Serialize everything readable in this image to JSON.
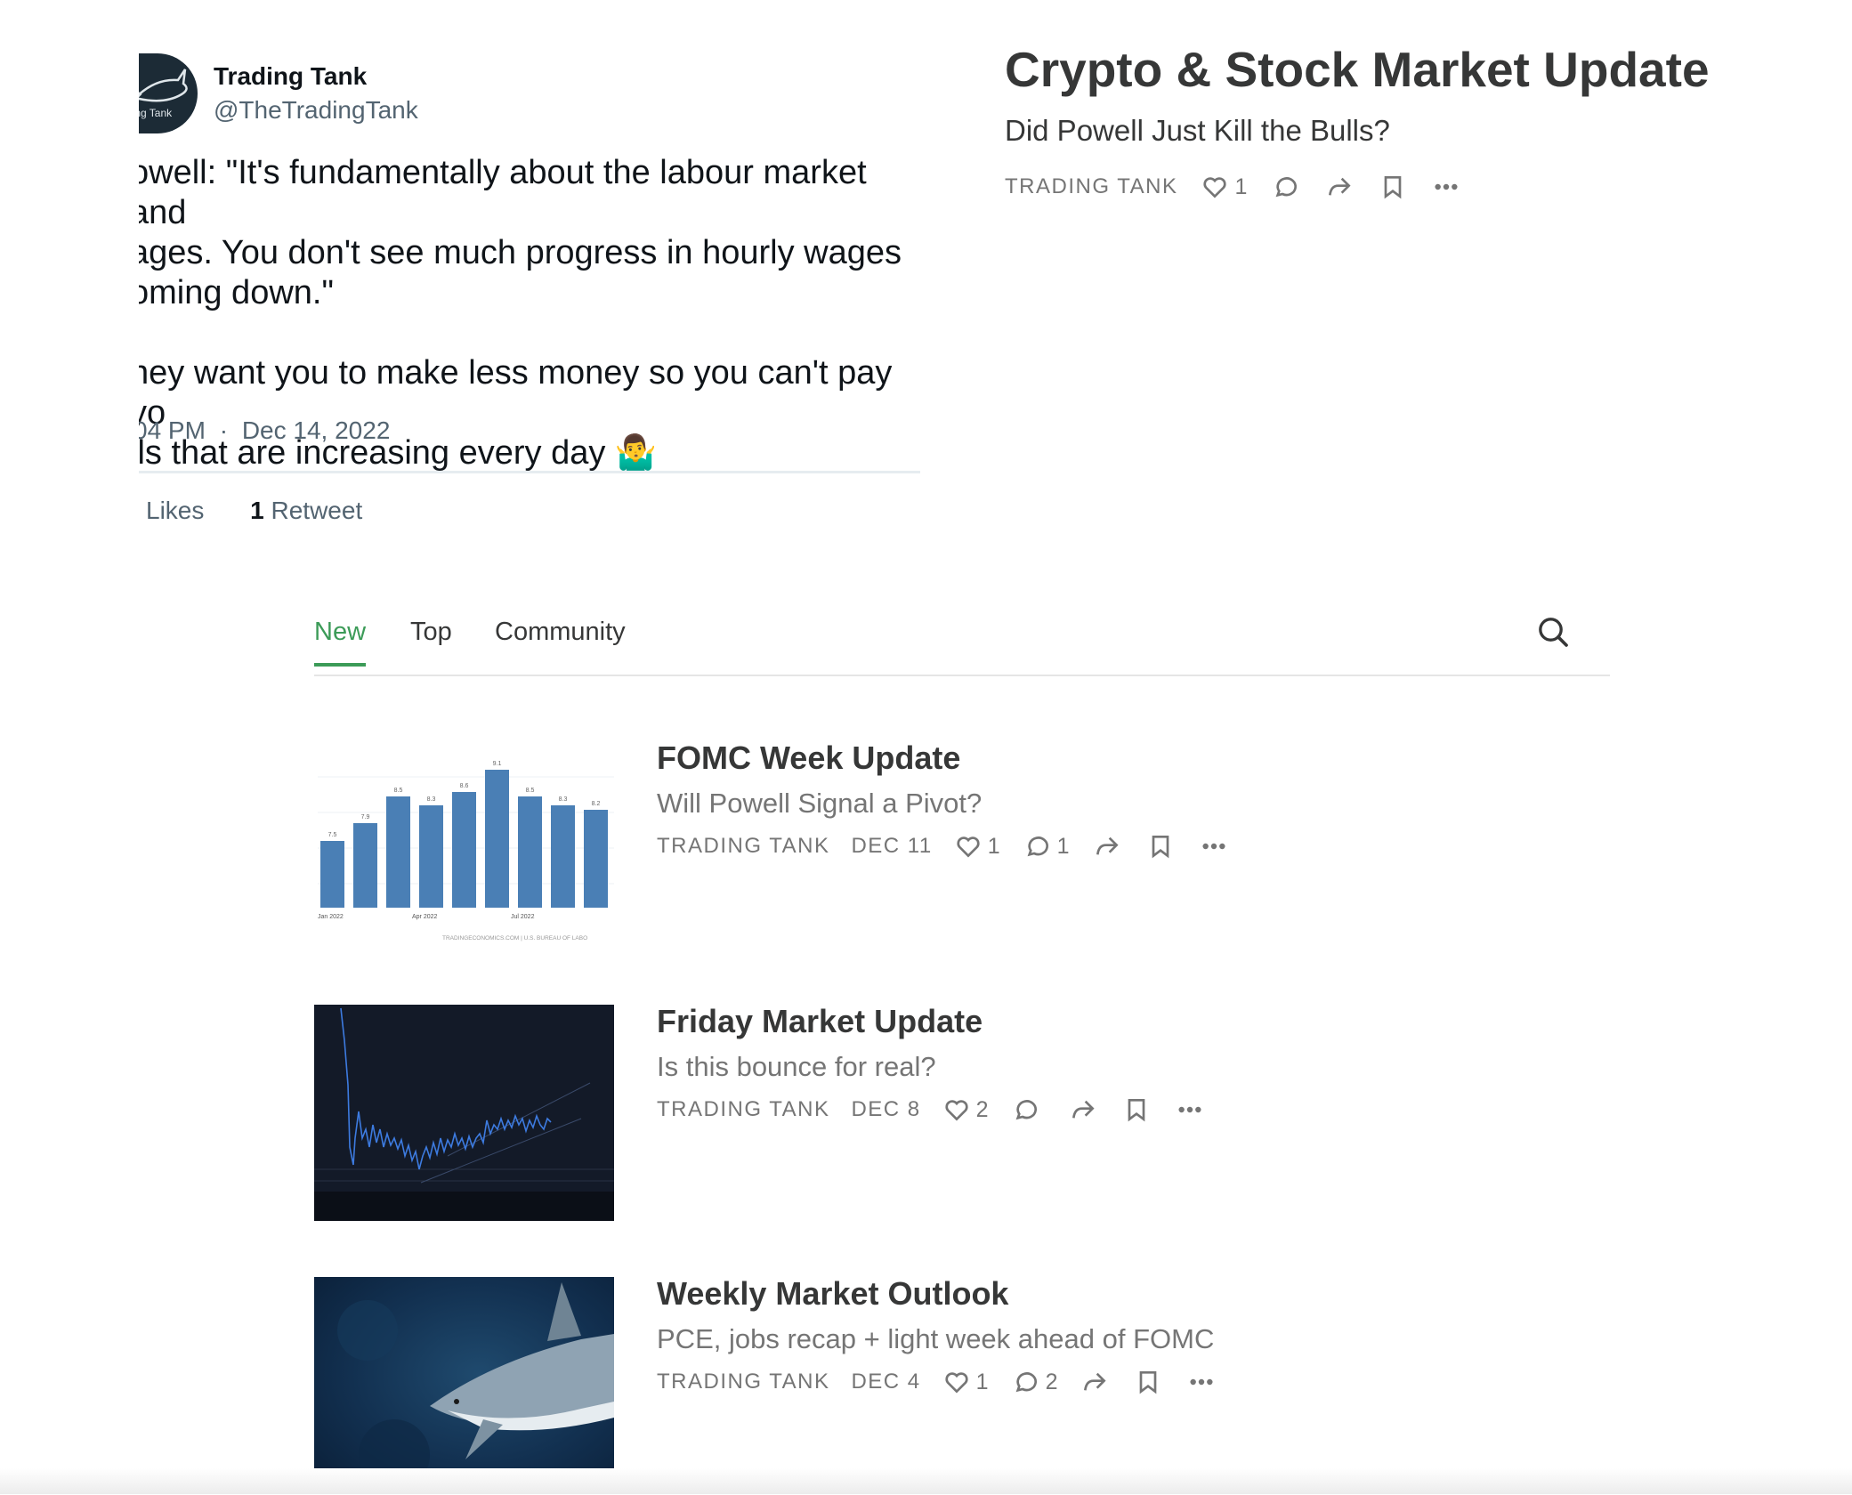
{
  "tweet": {
    "avatar_text": "ding Tank",
    "author_name": "Trading Tank",
    "author_handle": "@TheTradingTank",
    "text": "owell: \"It's fundamentally about the labour market and\nages. You don't see much progress in hourly wages\noming down.\"\n\nhey want you to make less money so you can't pay yo\nlls that are increasing every day 🤷‍♂️",
    "time": "04 PM",
    "separator": "·",
    "date": "Dec 14, 2022",
    "likes_label": "Likes",
    "retweet_count": "1",
    "retweet_label": "Retweet"
  },
  "featured": {
    "title": "Crypto & Stock Market Update",
    "subtitle": "Did Powell Just Kill the Bulls?",
    "publication": "TRADING TANK",
    "likes": "1"
  },
  "tabs": [
    {
      "label": "New",
      "active": true
    },
    {
      "label": "Top",
      "active": false
    },
    {
      "label": "Community",
      "active": false
    }
  ],
  "posts": [
    {
      "title": "FOMC Week Update",
      "subtitle": "Will Powell Signal a Pivot?",
      "publication": "TRADING TANK",
      "date": "DEC 11",
      "likes": "1",
      "comments": "1",
      "thumbnail": "cpi-bar-chart"
    },
    {
      "title": "Friday Market Update",
      "subtitle": "Is this bounce for real?",
      "publication": "TRADING TANK",
      "date": "DEC 8",
      "likes": "2",
      "comments": "",
      "thumbnail": "dark-price-chart"
    },
    {
      "title": "Weekly Market Outlook",
      "subtitle": "PCE, jobs recap + light week ahead of FOMC",
      "publication": "TRADING TANK",
      "date": "DEC 4",
      "likes": "1",
      "comments": "2",
      "thumbnail": "shark-photo"
    }
  ],
  "thumb_chart": {
    "values": [
      7.5,
      7.9,
      8.5,
      8.3,
      8.6,
      9.1,
      8.5,
      8.3,
      8.2
    ],
    "value_labels": [
      "7.5",
      "7.9",
      "8.5",
      "8.3",
      "8.6",
      "9.1",
      "8.5",
      "8.3",
      "8.2"
    ],
    "x_labels": [
      "Jan 2022",
      "Apr 2022",
      "Jul 2022"
    ],
    "source": "TRADINGECONOMICS.COM | U.S. BUREAU OF LABO"
  },
  "colors": {
    "accent_green": "#3c9b58",
    "text_dark": "#363737",
    "text_muted": "#757575",
    "bar_blue": "#4a7fb5"
  },
  "icons": [
    "heart-icon",
    "comment-icon",
    "share-icon",
    "bookmark-icon",
    "more-icon",
    "search-icon"
  ]
}
